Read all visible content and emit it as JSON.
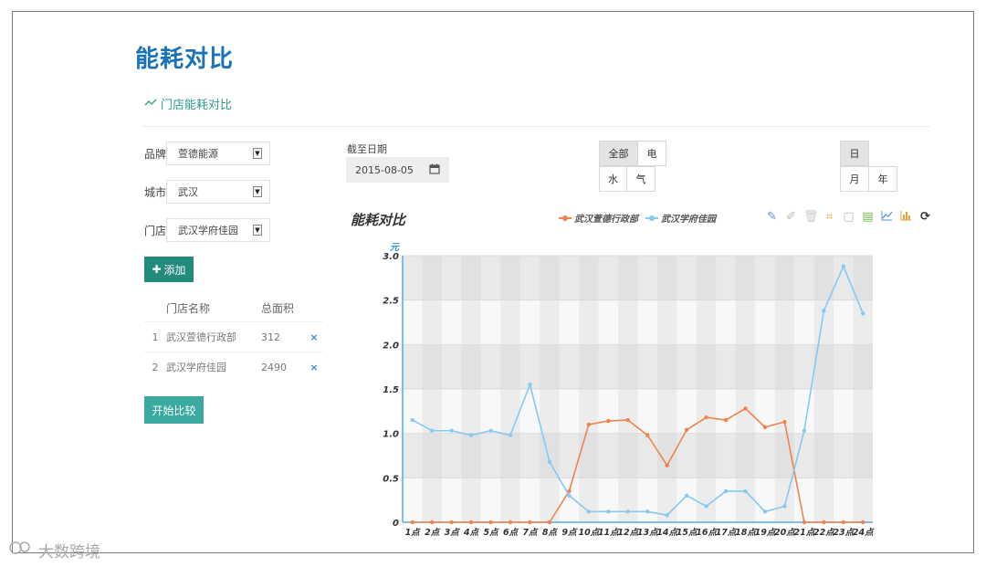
{
  "page": {
    "title": "能耗对比",
    "section_label": "门店能耗对比"
  },
  "filters": {
    "brand_label": "品牌",
    "brand_value": "萱德能源",
    "city_label": "城市",
    "city_value": "武汉",
    "store_label": "门店",
    "store_value": "武汉学府佳园"
  },
  "add_button": {
    "label": "添加"
  },
  "store_table": {
    "headers": [
      "门店名称",
      "总面积"
    ],
    "rows": [
      {
        "index": "1",
        "name": "武汉萱德行政部",
        "area": "312",
        "remove": "×"
      },
      {
        "index": "2",
        "name": "武汉学府佳园",
        "area": "2490",
        "remove": "×"
      }
    ]
  },
  "compare_button": {
    "label": "开始比较"
  },
  "date": {
    "label": "截至日期",
    "value": "2015-08-05"
  },
  "energy_type": {
    "all": "全部",
    "electric": "电",
    "water": "水",
    "gas": "气"
  },
  "period": {
    "day": "日",
    "month": "月",
    "year": "年"
  },
  "toolbox_icons": [
    "pencil-icon",
    "eraser-icon",
    "trash-icon",
    "crop-icon",
    "restore-icon",
    "data-view-icon",
    "line-chart-icon",
    "bar-chart-icon",
    "refresh-icon"
  ],
  "chart_data": {
    "type": "line",
    "title": "能耗对比",
    "ylabel": "元",
    "ylim": [
      0,
      3.0
    ],
    "yticks": [
      "0",
      "0.5",
      "1.0",
      "1.5",
      "2.0",
      "2.5",
      "3.0"
    ],
    "categories": [
      "1点",
      "2点",
      "3点",
      "4点",
      "5点",
      "6点",
      "7点",
      "8点",
      "9点",
      "10点",
      "11点",
      "12点",
      "13点",
      "14点",
      "15点",
      "16点",
      "17点",
      "18点",
      "19点",
      "20点",
      "21点",
      "22点",
      "23点",
      "24点"
    ],
    "series": [
      {
        "name": "武汉萱德行政部",
        "color": "#f0824c",
        "values": [
          0,
          0,
          0,
          0,
          0,
          0,
          0,
          0,
          0.35,
          1.1,
          1.14,
          1.15,
          0.98,
          0.64,
          1.04,
          1.18,
          1.15,
          1.28,
          1.07,
          1.13,
          0,
          0,
          0,
          0
        ]
      },
      {
        "name": "武汉学府佳园",
        "color": "#87c9f2",
        "values": [
          1.15,
          1.03,
          1.03,
          0.98,
          1.03,
          0.98,
          1.55,
          0.68,
          0.3,
          0.12,
          0.12,
          0.12,
          0.12,
          0.08,
          0.3,
          0.18,
          0.35,
          0.35,
          0.12,
          0.18,
          1.03,
          2.38,
          2.88,
          2.35
        ]
      }
    ],
    "legend": "top-right",
    "grid": true
  },
  "watermark": "大数跨境"
}
